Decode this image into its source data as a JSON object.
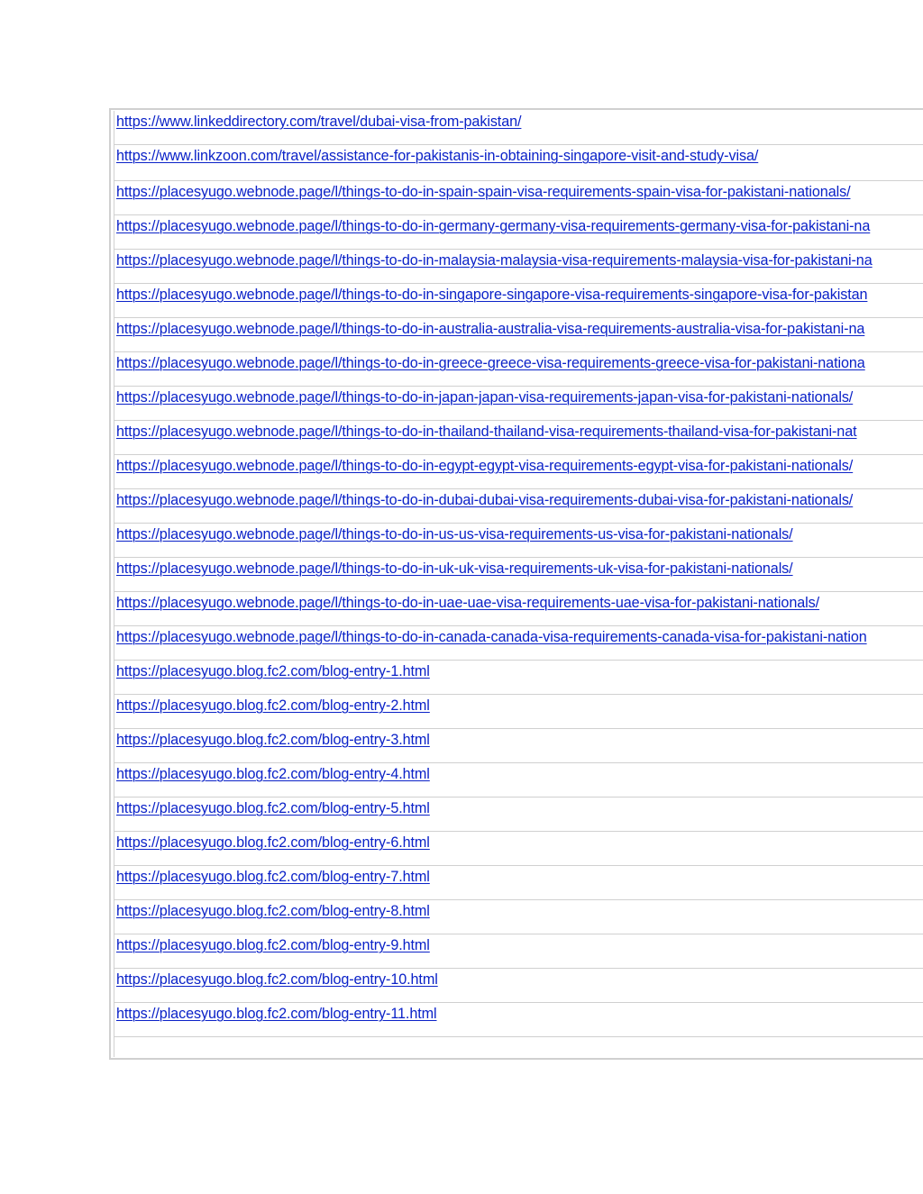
{
  "links": [
    "https://www.linkeddirectory.com/travel/dubai-visa-from-pakistan/",
    "https://www.linkzoon.com/travel/assistance-for-pakistanis-in-obtaining-singapore-visit-and-study-visa/",
    "https://placesyugo.webnode.page/l/things-to-do-in-spain-spain-visa-requirements-spain-visa-for-pakistani-nationals/",
    "https://placesyugo.webnode.page/l/things-to-do-in-germany-germany-visa-requirements-germany-visa-for-pakistani-na",
    "https://placesyugo.webnode.page/l/things-to-do-in-malaysia-malaysia-visa-requirements-malaysia-visa-for-pakistani-na",
    "https://placesyugo.webnode.page/l/things-to-do-in-singapore-singapore-visa-requirements-singapore-visa-for-pakistan",
    "https://placesyugo.webnode.page/l/things-to-do-in-australia-australia-visa-requirements-australia-visa-for-pakistani-na",
    "https://placesyugo.webnode.page/l/things-to-do-in-greece-greece-visa-requirements-greece-visa-for-pakistani-nationa",
    "https://placesyugo.webnode.page/l/things-to-do-in-japan-japan-visa-requirements-japan-visa-for-pakistani-nationals/",
    "https://placesyugo.webnode.page/l/things-to-do-in-thailand-thailand-visa-requirements-thailand-visa-for-pakistani-nat",
    "https://placesyugo.webnode.page/l/things-to-do-in-egypt-egypt-visa-requirements-egypt-visa-for-pakistani-nationals/",
    "https://placesyugo.webnode.page/l/things-to-do-in-dubai-dubai-visa-requirements-dubai-visa-for-pakistani-nationals/",
    "https://placesyugo.webnode.page/l/things-to-do-in-us-us-visa-requirements-us-visa-for-pakistani-nationals/",
    "https://placesyugo.webnode.page/l/things-to-do-in-uk-uk-visa-requirements-uk-visa-for-pakistani-nationals/",
    "https://placesyugo.webnode.page/l/things-to-do-in-uae-uae-visa-requirements-uae-visa-for-pakistani-nationals/",
    "https://placesyugo.webnode.page/l/things-to-do-in-canada-canada-visa-requirements-canada-visa-for-pakistani-nation",
    "https://placesyugo.blog.fc2.com/blog-entry-1.html",
    "https://placesyugo.blog.fc2.com/blog-entry-2.html",
    "https://placesyugo.blog.fc2.com/blog-entry-3.html",
    "https://placesyugo.blog.fc2.com/blog-entry-4.html",
    "https://placesyugo.blog.fc2.com/blog-entry-5.html",
    "https://placesyugo.blog.fc2.com/blog-entry-6.html",
    "https://placesyugo.blog.fc2.com/blog-entry-7.html",
    "https://placesyugo.blog.fc2.com/blog-entry-8.html",
    "https://placesyugo.blog.fc2.com/blog-entry-9.html",
    "https://placesyugo.blog.fc2.com/blog-entry-10.html",
    "https://placesyugo.blog.fc2.com/blog-entry-11.html"
  ],
  "colors": {
    "link": "#0b22c8",
    "border": "#d0d0d0",
    "page": "#ffffff"
  }
}
